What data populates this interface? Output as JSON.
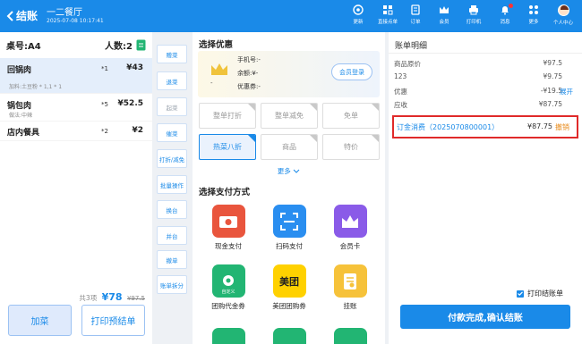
{
  "header": {
    "back_label": "结账",
    "shop_name": "一二餐厅",
    "datetime": "2025-07-08 10:17:41",
    "icons": [
      {
        "name": "update",
        "label": "更新"
      },
      {
        "name": "scan-order",
        "label": "直接点单"
      },
      {
        "name": "orders",
        "label": "订单"
      },
      {
        "name": "member",
        "label": "会员"
      },
      {
        "name": "printer",
        "label": "打印机"
      },
      {
        "name": "messages",
        "label": "消息"
      },
      {
        "name": "more",
        "label": "更多"
      },
      {
        "name": "user-center",
        "label": "个人中心"
      }
    ]
  },
  "order": {
    "table_label": "桌号:A4",
    "people_label": "人数:2",
    "items": [
      {
        "name": "回锅肉",
        "qty": "*1",
        "price": "¥43",
        "sub": "加料:土豆粉 * 1,1 * 1"
      },
      {
        "name": "锅包肉",
        "qty": "*5",
        "price": "¥52.5",
        "sub": "做法:中辣"
      },
      {
        "name": "店内餐具",
        "qty": "*2",
        "price": "¥2",
        "sub": ""
      }
    ],
    "summary_count": "共3项",
    "total": "¥78",
    "original": "¥97.5",
    "add_button": "加菜",
    "print_pre_button": "打印预结单"
  },
  "operations": [
    "赠菜",
    "退菜",
    "起菜",
    "催菜",
    "打折/减免",
    "批量操作",
    "换台",
    "并台",
    "撤单",
    "账单拆分"
  ],
  "discount": {
    "title": "选择优惠",
    "member": {
      "phone": "手机号:-",
      "balance": "余额:¥-",
      "coupon": "优惠券:-",
      "dash": "-",
      "login_button": "会员登录"
    },
    "options": [
      {
        "label": "整单打折",
        "selected": false
      },
      {
        "label": "整单减免",
        "selected": false
      },
      {
        "label": "免单",
        "selected": false
      },
      {
        "label": "热菜八折",
        "selected": true
      },
      {
        "label": "商品",
        "selected": false
      },
      {
        "label": "特价",
        "selected": false
      }
    ],
    "more_label": "更多"
  },
  "payment": {
    "title": "选择支付方式",
    "methods": [
      {
        "label": "现金支付",
        "icon": "cash-icon",
        "color": "#e9553d"
      },
      {
        "label": "扫码支付",
        "icon": "scan-icon",
        "color": "#2a8ef0"
      },
      {
        "label": "会员卡",
        "icon": "member-card-icon",
        "color": "#8a5be8"
      },
      {
        "label": "团购代金券",
        "icon": "voucher-icon",
        "color": "#22b573",
        "badge": "自定义"
      },
      {
        "label": "美团团购券",
        "icon": "meituan-icon",
        "color": "#ffd100",
        "text": "美团"
      },
      {
        "label": "挂账",
        "icon": "credit-icon",
        "color": "#f6c23a"
      }
    ]
  },
  "bill": {
    "title": "账单明细",
    "rows": [
      {
        "label": "商品原价",
        "value": "¥97.5"
      },
      {
        "label": "123",
        "value": "¥9.75"
      },
      {
        "label": "优惠",
        "value": "-¥19.5",
        "action": "展开"
      },
      {
        "label": "应收",
        "value": "¥87.75"
      }
    ],
    "payment_row": {
      "label": "订金消费（2025070800001）",
      "value": "¥87.75",
      "action": "撤销"
    },
    "print_checkbox_label": "打印结账单",
    "finish_button": "付款完成,确认结账"
  },
  "colors": {
    "primary": "#1a8ae8",
    "highlight_border": "#e02a2a"
  }
}
